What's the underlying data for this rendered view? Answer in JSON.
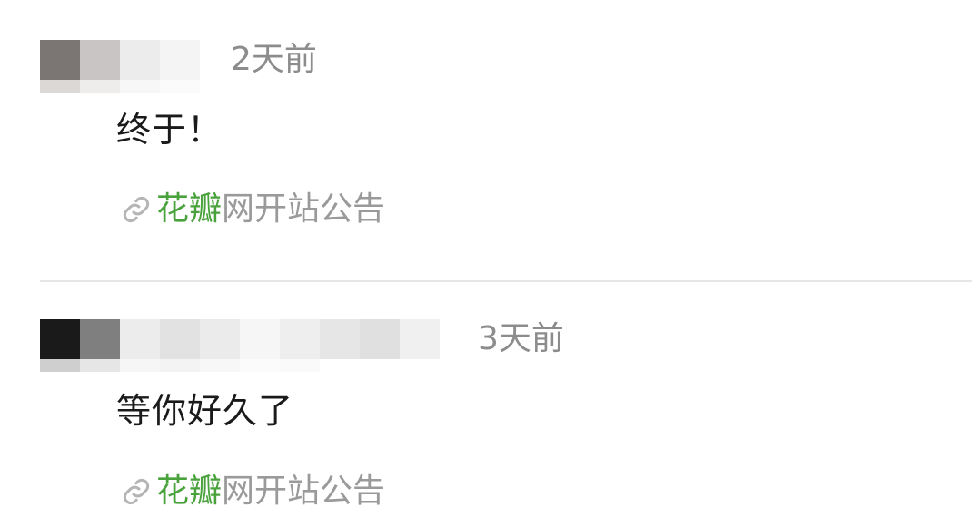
{
  "comments": [
    {
      "time": "2天前",
      "text": "终于！",
      "link": {
        "highlight": "花瓣",
        "rest": "网开站公告",
        "icon": "link-icon"
      },
      "username_mosaic": [
        "#7b7673",
        "#c9c5c4",
        "#ececec",
        "#f1f1f1"
      ]
    },
    {
      "time": "3天前",
      "text": "等你好久了",
      "link": {
        "highlight": "花瓣",
        "rest": "网开站公告",
        "icon": "link-icon"
      },
      "username_mosaic": [
        "#1a1a1a",
        "#7f7f7f",
        "#ececec",
        "#e2e2e2",
        "#ebebeb",
        "#f6f6f6",
        "#eeeeee",
        "#e6e6e6",
        "#e0e0e0",
        "#f0f0f0"
      ]
    }
  ],
  "colors": {
    "link_highlight": "#4aa23d",
    "link_rest": "#9a9a9a",
    "time": "#8c8c8c",
    "divider": "#e6e6e6"
  }
}
